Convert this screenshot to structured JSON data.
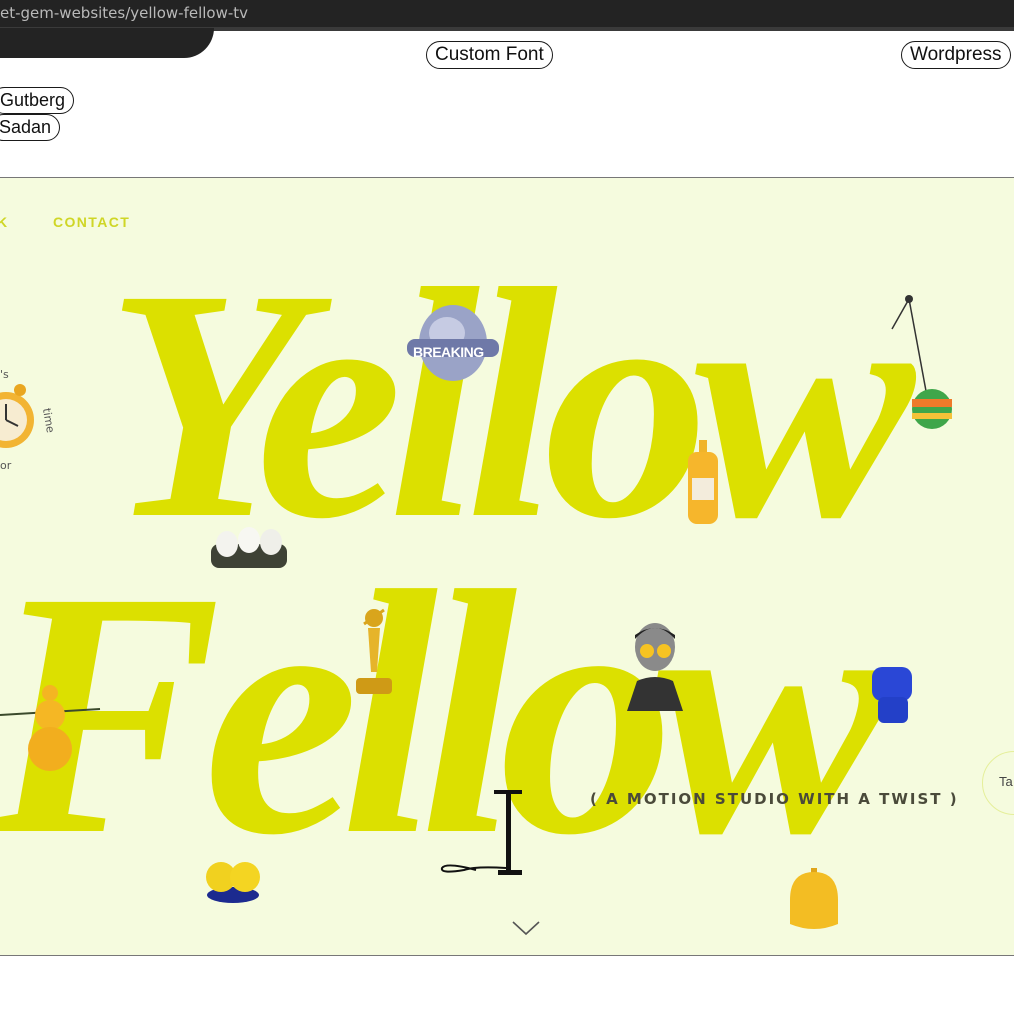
{
  "browser": {
    "url_text": "et-gem-websites/yellow-fellow-tv"
  },
  "tags": {
    "font_label": "Custom Font",
    "platform_label": "Wordpress",
    "designers": [
      "Gutberg",
      "Sadan"
    ]
  },
  "site": {
    "nav": {
      "partial_item": "K",
      "contact": "CONTACT"
    },
    "headline_line1": "Yellow",
    "headline_line2": "Fellow",
    "tagline": "( A MOTION STUDIO WITH A TWIST )",
    "clock_text": {
      "top": "'s",
      "right": "time",
      "bottom": "or"
    },
    "globe_label": "BREAKING",
    "side_button": "Ta",
    "colors": {
      "brand_yellow": "#dce000",
      "background": "#f5fbde",
      "nav_text": "#cfd626"
    }
  }
}
